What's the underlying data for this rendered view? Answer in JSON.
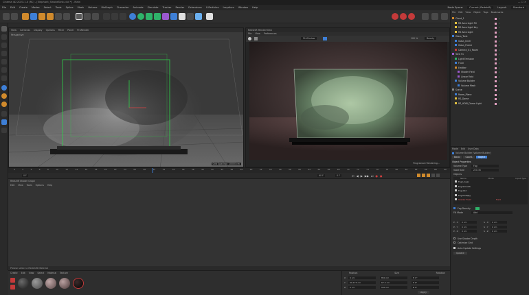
{
  "window": {
    "title": "Cinema 4D 2023.1.0 (RC) - [Elephant_SmokeTank.c4d *] - Main"
  },
  "menu": {
    "items": [
      "File",
      "Edit",
      "Create",
      "Modes",
      "Select",
      "Tools",
      "Spline",
      "Mesh",
      "Volume",
      "MoGraph",
      "Character",
      "Animate",
      "Simulate",
      "Tracker",
      "Render",
      "Extensions",
      "X-Particles",
      "Insydium",
      "Window",
      "Help"
    ],
    "right_items": [
      "Node Space:",
      "Current (Redshift)",
      "Layout:",
      "Standard"
    ]
  },
  "viewport": {
    "header_items": [
      "View",
      "Cameras",
      "Display",
      "Options",
      "Filter",
      "Panel",
      "ProRender"
    ],
    "label": "Perspective",
    "grid_spacing": "Grid Spacing : 10000 cm"
  },
  "render_view": {
    "title": "Redshift RenderView",
    "header_items": [
      "File",
      "View",
      "Preferences"
    ],
    "zoom": "100 %",
    "fit": "Fit Window",
    "beauty": "Beauty",
    "status": "Progressive Rendering..."
  },
  "timeline": {
    "ticks": [
      "0",
      "2",
      "4",
      "6",
      "8",
      "10",
      "12",
      "14",
      "16",
      "18",
      "20",
      "22",
      "24",
      "26",
      "28",
      "30",
      "32",
      "34",
      "36",
      "38",
      "40",
      "42",
      "44",
      "46",
      "48",
      "50",
      "52",
      "54",
      "56",
      "58",
      "60",
      "62",
      "64",
      "66",
      "68",
      "70",
      "72",
      "74",
      "76",
      "78",
      "80",
      "82",
      "84",
      "86",
      "88",
      "90"
    ],
    "start_frame": "0 F",
    "end_frame": "90 F",
    "current_frame": "0 F"
  },
  "shader_graph": {
    "title": "Redshift Shader Graph",
    "menu": [
      "Edit",
      "View",
      "Tools",
      "Options",
      "Help"
    ]
  },
  "status": {
    "text": "Please select a Redshift Material"
  },
  "material_manager": {
    "menu": [
      "Create",
      "Edit",
      "View",
      "Select",
      "Material",
      "Texture"
    ],
    "swatch_colors": [
      "#b03030",
      "#3a3a3a",
      "#6a6a6a",
      "#8a7878",
      "#7a6a6a",
      "#1a1a1a"
    ]
  },
  "coordinates": {
    "headers": [
      "Position",
      "Size",
      "Rotation"
    ],
    "rows": [
      {
        "axis": "X",
        "pos": "0 cm",
        "size": "850 cm",
        "rot": "H 0°"
      },
      {
        "axis": "Y",
        "pos": "99.175 cm",
        "size": "67.5 cm",
        "rot": "P 0°"
      },
      {
        "axis": "Z",
        "pos": "0 cm",
        "size": "500 cm",
        "rot": "B 0°"
      }
    ],
    "apply": "Apply"
  },
  "object_manager": {
    "menu": [
      "File",
      "Edit",
      "View",
      "Object",
      "Tags",
      "Bookmarks"
    ],
    "objects": [
      "Cloud_1",
      "RS Area Light Fill",
      "RS Area Light Key",
      "RS Area Light",
      "Glass_Tank",
      "Glass_Inner",
      "Glass_Frame",
      "Camera_01_Room",
      "Tank Fx",
      "Light Emission",
      "Fluid",
      "Emitter",
      "Shader Field",
      "Linear Field",
      "Volume Builder",
      "Volume Mesh",
      "Scene",
      "Room_Plane",
      "RS_Dome",
      "RS_HDRI_Dome Light"
    ]
  },
  "attributes": {
    "tabs_menu": [
      "Mode",
      "Edit",
      "User Data"
    ],
    "title": "Volume Builder [Volume Builder]",
    "tabs": [
      "Basic",
      "Coord.",
      "Object"
    ],
    "section": "Object Properties",
    "volume_type_label": "Volume Type",
    "volume_type": "Fog",
    "voxel_size_label": "Voxel Size",
    "voxel_size": "2.5 cm",
    "objects_label": "Objects",
    "list_headers": [
      "Name",
      "Mode",
      "Input Type"
    ],
    "list_items": [
      {
        "name": "Fog Linear",
        "mode": "",
        "type": ""
      },
      {
        "name": "Fog Smooth",
        "mode": "",
        "type": ""
      },
      {
        "name": "Fog Add",
        "mode": "",
        "type": ""
      },
      {
        "name": "Fog Multiply",
        "mode": "",
        "type": ""
      },
      {
        "name": "Shader Field",
        "mode": "Field",
        "type": ""
      }
    ],
    "fields": [
      {
        "label": "Fog Density",
        "value": ""
      },
      {
        "label": "Fill Mode",
        "value": "Add"
      }
    ],
    "vector_rows": [
      {
        "label": "P . X",
        "val1": "0 cm",
        "label2": "S . X",
        "val2": "0 cm"
      },
      {
        "label": "P . Y",
        "val1": "0 cm",
        "label2": "S . Y",
        "val2": "0 cm"
      },
      {
        "label": "P . Z",
        "val1": "0 cm",
        "label2": "S . Z",
        "val2": "0 cm"
      }
    ],
    "checks": [
      "Use Shader Depth",
      "Optimize Grid",
      "Auto Update Settings"
    ],
    "update_button": "Update"
  }
}
